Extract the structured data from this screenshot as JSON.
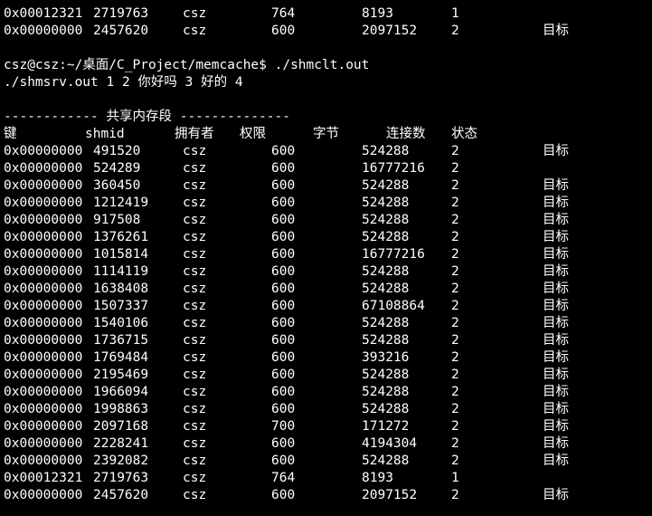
{
  "top_rows": [
    {
      "key": "0x00012321",
      "shmid": "2719763",
      "owner": "csz",
      "perms": "764",
      "bytes": "8193",
      "nattch": "1",
      "status": ""
    },
    {
      "key": "0x00000000",
      "shmid": "2457620",
      "owner": "csz",
      "perms": "600",
      "bytes": "2097152",
      "nattch": "2",
      "status": "目标"
    }
  ],
  "prompt_line": "csz@csz:~/桌面/C_Project/memcache$ ./shmclt.out",
  "output_line": "./shmsrv.out 1 2 你好吗 3 好的 4",
  "section_title": "------------ 共享内存段 --------------",
  "headers": {
    "key": "键",
    "shmid": "shmid",
    "owner": "拥有者",
    "perms": "权限",
    "bytes": "字节",
    "nattch": "连接数",
    "status": "状态"
  },
  "rows": [
    {
      "key": "0x00000000",
      "shmid": "491520",
      "owner": "csz",
      "perms": "600",
      "bytes": "524288",
      "nattch": "2",
      "status": "目标"
    },
    {
      "key": "0x00000000",
      "shmid": "524289",
      "owner": "csz",
      "perms": "600",
      "bytes": "16777216",
      "nattch": "2",
      "status": ""
    },
    {
      "key": "0x00000000",
      "shmid": "360450",
      "owner": "csz",
      "perms": "600",
      "bytes": "524288",
      "nattch": "2",
      "status": "目标"
    },
    {
      "key": "0x00000000",
      "shmid": "1212419",
      "owner": "csz",
      "perms": "600",
      "bytes": "524288",
      "nattch": "2",
      "status": "目标"
    },
    {
      "key": "0x00000000",
      "shmid": "917508",
      "owner": "csz",
      "perms": "600",
      "bytes": "524288",
      "nattch": "2",
      "status": "目标"
    },
    {
      "key": "0x00000000",
      "shmid": "1376261",
      "owner": "csz",
      "perms": "600",
      "bytes": "524288",
      "nattch": "2",
      "status": "目标"
    },
    {
      "key": "0x00000000",
      "shmid": "1015814",
      "owner": "csz",
      "perms": "600",
      "bytes": "16777216",
      "nattch": "2",
      "status": "目标"
    },
    {
      "key": "0x00000000",
      "shmid": "1114119",
      "owner": "csz",
      "perms": "600",
      "bytes": "524288",
      "nattch": "2",
      "status": "目标"
    },
    {
      "key": "0x00000000",
      "shmid": "1638408",
      "owner": "csz",
      "perms": "600",
      "bytes": "524288",
      "nattch": "2",
      "status": "目标"
    },
    {
      "key": "0x00000000",
      "shmid": "1507337",
      "owner": "csz",
      "perms": "600",
      "bytes": "67108864",
      "nattch": "2",
      "status": "目标"
    },
    {
      "key": "0x00000000",
      "shmid": "1540106",
      "owner": "csz",
      "perms": "600",
      "bytes": "524288",
      "nattch": "2",
      "status": "目标"
    },
    {
      "key": "0x00000000",
      "shmid": "1736715",
      "owner": "csz",
      "perms": "600",
      "bytes": "524288",
      "nattch": "2",
      "status": "目标"
    },
    {
      "key": "0x00000000",
      "shmid": "1769484",
      "owner": "csz",
      "perms": "600",
      "bytes": "393216",
      "nattch": "2",
      "status": "目标"
    },
    {
      "key": "0x00000000",
      "shmid": "2195469",
      "owner": "csz",
      "perms": "600",
      "bytes": "524288",
      "nattch": "2",
      "status": "目标"
    },
    {
      "key": "0x00000000",
      "shmid": "1966094",
      "owner": "csz",
      "perms": "600",
      "bytes": "524288",
      "nattch": "2",
      "status": "目标"
    },
    {
      "key": "0x00000000",
      "shmid": "1998863",
      "owner": "csz",
      "perms": "600",
      "bytes": "524288",
      "nattch": "2",
      "status": "目标"
    },
    {
      "key": "0x00000000",
      "shmid": "2097168",
      "owner": "csz",
      "perms": "700",
      "bytes": "171272",
      "nattch": "2",
      "status": "目标"
    },
    {
      "key": "0x00000000",
      "shmid": "2228241",
      "owner": "csz",
      "perms": "600",
      "bytes": "4194304",
      "nattch": "2",
      "status": "目标"
    },
    {
      "key": "0x00000000",
      "shmid": "2392082",
      "owner": "csz",
      "perms": "600",
      "bytes": "524288",
      "nattch": "2",
      "status": "目标"
    },
    {
      "key": "0x00012321",
      "shmid": "2719763",
      "owner": "csz",
      "perms": "764",
      "bytes": "8193",
      "nattch": "1",
      "status": ""
    },
    {
      "key": "0x00000000",
      "shmid": "2457620",
      "owner": "csz",
      "perms": "600",
      "bytes": "2097152",
      "nattch": "2",
      "status": "目标"
    }
  ]
}
